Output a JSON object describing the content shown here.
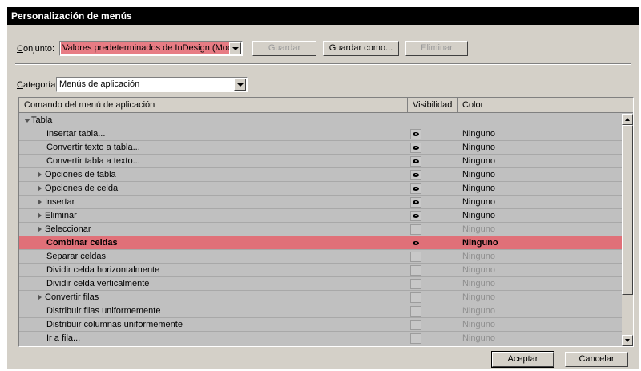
{
  "window": {
    "title": "Personalización de menús"
  },
  "set": {
    "label_u": "C",
    "label_rest": "onjunto:",
    "value": "Valores predeterminados de InDesign (Modif",
    "highlight": "#e77c84"
  },
  "buttons": {
    "save": "Guardar",
    "save_as": "Guardar como...",
    "delete": "Eliminar",
    "ok": "Aceptar",
    "cancel": "Cancelar"
  },
  "category": {
    "label_u": "C",
    "label_rest": "ategoría:",
    "value": "Menús de aplicación"
  },
  "table": {
    "headers": {
      "command": "Comando del menú de aplicación",
      "visibility": "Visibilidad",
      "color": "Color"
    },
    "rows": [
      {
        "label": "Tabla",
        "indent": 0,
        "expander": "down",
        "visible": null,
        "color": ""
      },
      {
        "label": "Insertar tabla...",
        "indent": 2,
        "expander": "",
        "visible": true,
        "color": "Ninguno"
      },
      {
        "label": "Convertir texto a tabla...",
        "indent": 2,
        "expander": "",
        "visible": true,
        "color": "Ninguno"
      },
      {
        "label": "Convertir tabla a texto...",
        "indent": 2,
        "expander": "",
        "visible": true,
        "color": "Ninguno"
      },
      {
        "label": "Opciones de tabla",
        "indent": 1,
        "expander": "right",
        "visible": true,
        "color": "Ninguno"
      },
      {
        "label": "Opciones de celda",
        "indent": 1,
        "expander": "right",
        "visible": true,
        "color": "Ninguno"
      },
      {
        "label": "Insertar",
        "indent": 1,
        "expander": "right",
        "visible": true,
        "color": "Ninguno"
      },
      {
        "label": "Eliminar",
        "indent": 1,
        "expander": "right",
        "visible": true,
        "color": "Ninguno"
      },
      {
        "label": "Seleccionar",
        "indent": 1,
        "expander": "right",
        "visible": false,
        "color": "Ninguno"
      },
      {
        "label": "Combinar celdas",
        "indent": 2,
        "expander": "",
        "visible": true,
        "color": "Ninguno",
        "selected": true
      },
      {
        "label": "Separar celdas",
        "indent": 2,
        "expander": "",
        "visible": false,
        "color": "Ninguno"
      },
      {
        "label": "Dividir celda horizontalmente",
        "indent": 2,
        "expander": "",
        "visible": false,
        "color": "Ninguno"
      },
      {
        "label": "Dividir celda verticalmente",
        "indent": 2,
        "expander": "",
        "visible": false,
        "color": "Ninguno"
      },
      {
        "label": "Convertir filas",
        "indent": 1,
        "expander": "right",
        "visible": false,
        "color": "Ninguno"
      },
      {
        "label": "Distribuir filas uniformemente",
        "indent": 2,
        "expander": "",
        "visible": false,
        "color": "Ninguno"
      },
      {
        "label": "Distribuir columnas uniformemente",
        "indent": 2,
        "expander": "",
        "visible": false,
        "color": "Ninguno"
      },
      {
        "label": "Ir a fila...",
        "indent": 2,
        "expander": "",
        "visible": false,
        "color": "Ninguno"
      }
    ]
  },
  "colors": {
    "selected_row": "#e07078",
    "dialog_bg": "#d4d0c8",
    "list_bg": "#c0c0c0",
    "dim_text": "#8e8e8e"
  }
}
